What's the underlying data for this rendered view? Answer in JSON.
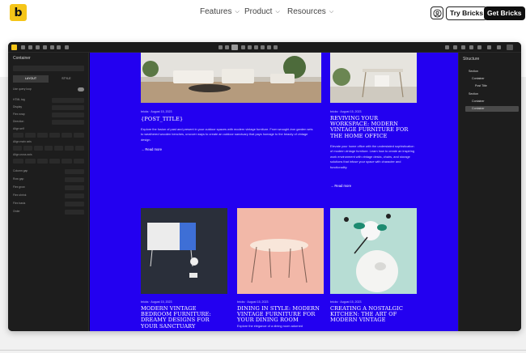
{
  "header": {
    "logo_letter": "b",
    "nav": [
      {
        "label": "Features"
      },
      {
        "label": "Product"
      },
      {
        "label": "Resources"
      }
    ],
    "try_label": "Try Bricks",
    "get_label": "Get Bricks"
  },
  "builder": {
    "left_panel": {
      "title": "Container",
      "tabs": [
        "LAYOUT",
        "STYLE"
      ],
      "fields": [
        "Use query loop",
        "HTML tag",
        "Display",
        "Flex wrap",
        "Direction",
        "Align self",
        "Align main axis",
        "Align cross axis",
        "Column gap",
        "Row gap",
        "Flex grow",
        "Flex shrink",
        "Flex basis",
        "Order"
      ]
    },
    "right_panel": {
      "title": "Structure",
      "tree": [
        "Section",
        "Container",
        "Post Title",
        "Section",
        "Container",
        "Container"
      ]
    },
    "posts_top": [
      {
        "meta": "bricks  ·  August 15, 2023",
        "title": "{POST_TITLE}",
        "excerpt": "Explore the fusion of past and present in your outdoor spaces with modern vintage furniture. From wrought-iron garden sets to weathered wooden benches, uncover ways to create an outdoor sanctuary that pays homage to the beauty of vintage design.",
        "more": "Read more"
      },
      {
        "meta": "bricks  ·  August 15, 2023",
        "title": "REVIVING YOUR WORKSPACE: MODERN VINTAGE FURNITURE FOR THE HOME OFFICE",
        "excerpt": "Elevate your home office with the understated sophistication of modern vintage furniture. Learn how to create an inspiring work environment with vintage desks, chairs, and storage solutions that infuse your space with character and functionality.",
        "more": "Read more"
      }
    ],
    "posts_bottom": [
      {
        "meta": "bricks  ·  August 15, 2023",
        "title": "MODERN VINTAGE BEDROOM FURNITURE: DREAMY DESIGNS FOR YOUR SANCTUARY"
      },
      {
        "meta": "bricks  ·  August 15, 2023",
        "title": "DINING IN STYLE: MODERN VINTAGE FURNITURE FOR YOUR DINING ROOM",
        "excerpt": "Explore the elegance of a dining room adorned"
      },
      {
        "meta": "bricks  ·  August 15, 2023",
        "title": "CREATING A NOSTALGIC KITCHEN: THE ART OF MODERN VINTAGE"
      }
    ]
  },
  "colors": {
    "accent": "#f5c518",
    "canvas": "#2300f0",
    "panel": "#1d1d1d"
  }
}
